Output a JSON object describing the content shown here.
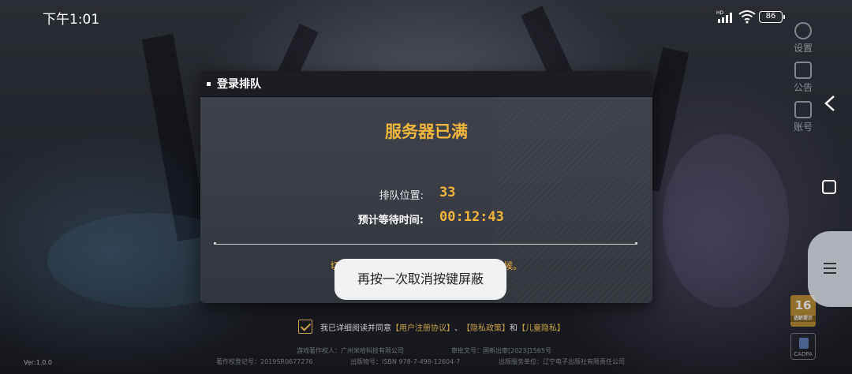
{
  "status_bar": {
    "time": "下午1:01",
    "network": "HD",
    "battery": "86"
  },
  "side_menu": {
    "items": [
      {
        "label": "设置",
        "icon": "gear-icon"
      },
      {
        "label": "公告",
        "icon": "notice-icon"
      },
      {
        "label": "账号",
        "icon": "account-icon"
      }
    ]
  },
  "dialog": {
    "title": "登录排队",
    "status": "服务器已满",
    "queue_position_label": "排队位置:",
    "queue_position": "33",
    "wait_time_label": "预计等待时间:",
    "wait_time": "00:12:43",
    "notice": "切换后台30秒会中断排队进度，请耐心等候。"
  },
  "toast": {
    "message": "再按一次取消按键屏蔽"
  },
  "agreement": {
    "prefix": "我已详细阅读并同意",
    "link_user": "【用户注册协议】",
    "sep1": "、",
    "link_privacy": "【隐私政策】",
    "and": "和",
    "link_child": "【儿童隐私】"
  },
  "fine_print": {
    "copyright_owner": "游戏著作权人：广州米哈科技有限公司",
    "approval": "审批文号：国新出审[2023]1565号",
    "registration": "著作权登记号：2019SR0677276",
    "isbn": "出版物号：ISBN 978-7-498-12604-7",
    "publisher": "出版服务单位：辽宁电子出版社有限责任公司"
  },
  "badges": {
    "age_rating": "16",
    "age_rating_sub": "适龄提示",
    "cadpa": "CADPA"
  },
  "version": "Ver:1.0.0",
  "colors": {
    "accent": "#f3b63d",
    "dialog_header": "#1c1d22",
    "dialog_body": "#3a3d45"
  }
}
